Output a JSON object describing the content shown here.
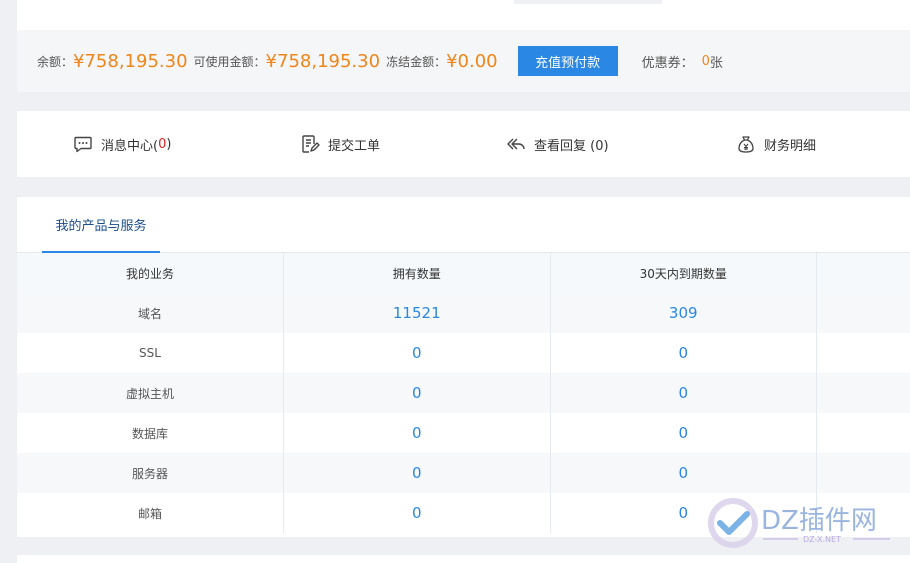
{
  "balance": {
    "balance_label": "余额：",
    "balance_value": "¥758,195.30",
    "available_label": "可使用金额：",
    "available_value": "¥758,195.30",
    "frozen_label": "冻结金额：",
    "frozen_value": "¥0.00",
    "recharge_button": "充值预付款",
    "coupon_label": "优惠券：",
    "coupon_count": "0",
    "coupon_unit": "张"
  },
  "quick_nav": {
    "messages_label": "消息中心(",
    "messages_count": "0",
    "messages_close": ")",
    "ticket_label": "提交工单",
    "replies_label": "查看回复 (0)",
    "finance_label": "财务明细"
  },
  "products": {
    "tab_label": "我的产品与服务",
    "columns": [
      "我的业务",
      "拥有数量",
      "30天内到期数量",
      ""
    ],
    "rows": [
      {
        "name": "域名",
        "owned": "11521",
        "expiring": "309"
      },
      {
        "name": "SSL",
        "owned": "0",
        "expiring": "0"
      },
      {
        "name": "虚拟主机",
        "owned": "0",
        "expiring": "0"
      },
      {
        "name": "数据库",
        "owned": "0",
        "expiring": "0"
      },
      {
        "name": "服务器",
        "owned": "0",
        "expiring": "0"
      },
      {
        "name": "邮箱",
        "owned": "0",
        "expiring": "0"
      }
    ]
  },
  "watermark": {
    "brand": "DZ插件网",
    "url": "DZ-X.NET"
  },
  "colors": {
    "accent_blue": "#2a87e4",
    "amount_orange": "#f08519",
    "count_red": "#e02020"
  }
}
